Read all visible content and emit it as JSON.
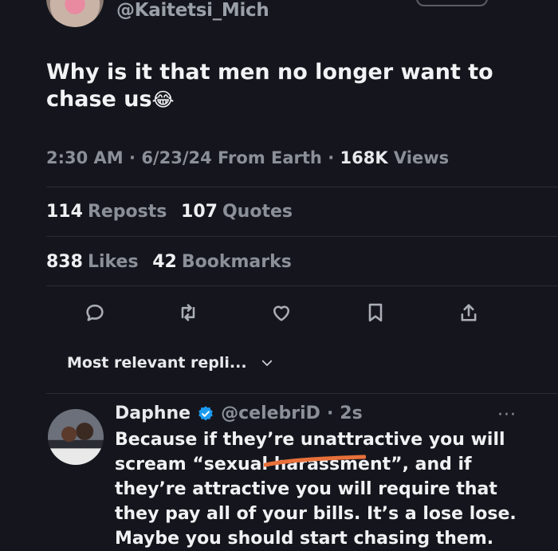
{
  "tweet": {
    "handle": "@Kaitetsi_Mich",
    "text": "Why is it that men no longer want to chase us",
    "emoji": "😂",
    "time": "2:30 AM",
    "date": "6/23/24",
    "source": "From Earth",
    "views_count": "168K",
    "views_label": "Views",
    "sep": "·"
  },
  "stats": {
    "reposts_count": "114",
    "reposts_label": "Reposts",
    "quotes_count": "107",
    "quotes_label": "Quotes",
    "likes_count": "838",
    "likes_label": "Likes",
    "bookmarks_count": "42",
    "bookmarks_label": "Bookmarks"
  },
  "actions": [
    "reply-icon",
    "repost-icon",
    "like-icon",
    "bookmark-icon",
    "share-icon"
  ],
  "sort": {
    "label": "Most relevant repli..."
  },
  "reply": {
    "name": "Daphne",
    "handle": "@celebriD",
    "sep": "·",
    "age": "2s",
    "more": "···",
    "lines": [
      "Because if they’re unattractive you will",
      "scream “sexual harassment”, and if",
      "they’re attractive you will require that",
      "they pay all of your bills. It’s a lose lose.",
      "Maybe you should start chasing them."
    ]
  },
  "colors": {
    "background": "#15161d",
    "muted": "#8b9098",
    "verified": "#1d9bf0",
    "scribble": "#e8703a"
  }
}
